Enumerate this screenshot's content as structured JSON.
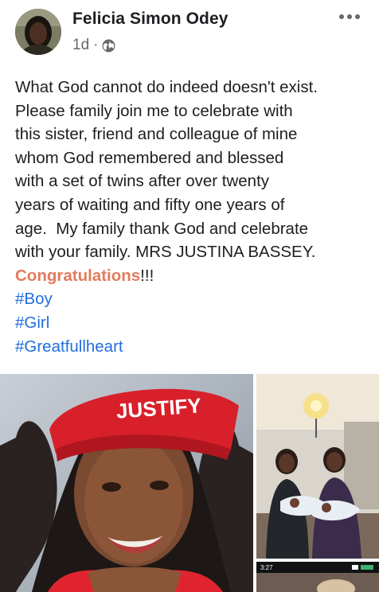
{
  "post": {
    "author": "Felicia Simon Odey",
    "time": "1d",
    "separator": "·",
    "privacy_icon": "globe-icon",
    "more_icon": "more-options-icon",
    "lines": [
      "What God cannot do indeed doesn't exist.",
      "Please family join me to celebrate with",
      "this sister, friend and colleague of mine",
      "whom God remembered and blessed",
      "with a set of twins after over twenty",
      "years of waiting and fifty one years of",
      "age.  My family thank God and celebrate",
      "with your family. MRS JUSTINA BASSEY."
    ],
    "congrats_word": "Congratulations",
    "congrats_suffix": "!!!",
    "hashtags": [
      "#Boy",
      "#Girl",
      "#Greatfullheart"
    ]
  },
  "photos": {
    "cap_text": "JUSTIFY",
    "phone_time": "3:27"
  },
  "colors": {
    "hashtag": "#216fdb",
    "congrats": "#e17c5c",
    "meta": "#65676b"
  }
}
